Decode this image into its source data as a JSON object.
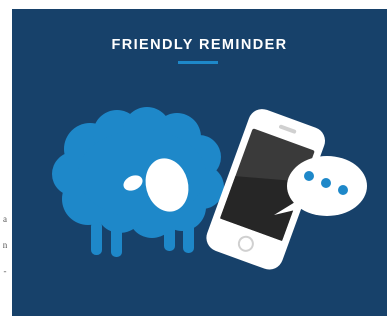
{
  "card": {
    "title": "FRIENDLY REMINDER",
    "background_color": "#17416a",
    "accent_color": "#1e88c9",
    "illustration": {
      "subject": "sheep-icon",
      "device": "smartphone-icon",
      "bubble": "speech-bubble-icon",
      "bubble_dots": 3
    }
  },
  "left_edge_glyphs": [
    "a",
    "n",
    "-"
  ]
}
